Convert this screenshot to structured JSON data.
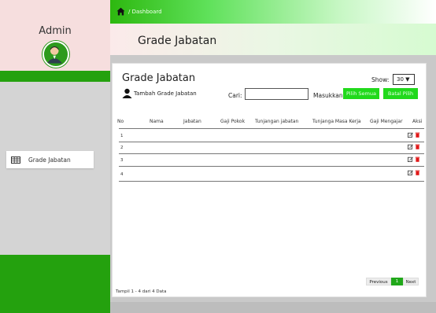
{
  "sidebar": {
    "title": "Admin",
    "menu": [
      {
        "label": "Grade Jabatan",
        "icon": "table-icon"
      }
    ]
  },
  "topbar": {
    "breadcrumb": "/ Dashboard",
    "icon": "home-icon"
  },
  "header": {
    "title": "Grade Jabatan"
  },
  "card": {
    "title": "Grade Jabatan",
    "add_label": "Tambah Grade Jabatan",
    "show_label": "Show:",
    "show_value": "30 ▼",
    "search_label": "Cari:",
    "search_value": "",
    "masukkan_label": "Masukkan:",
    "pilih_semua_label": "Pilih Semua",
    "batal_pilih_label": "Batal Pilih"
  },
  "table": {
    "columns": [
      "No",
      "Nama",
      "Jabatan",
      "Gaji Pokok",
      "Tunjangan jabatan",
      "Tunjanga Masa Kerja",
      "Gaji Mengajar",
      "Aksi"
    ],
    "rows": [
      [
        "1"
      ],
      [
        "2"
      ],
      [
        "3"
      ],
      [
        "4"
      ]
    ]
  },
  "footer": {
    "info": "Tampil 1 - 4 dari 4 Data",
    "prev_label": "Previous",
    "page_label": "1",
    "next_label": "Next"
  },
  "colors": {
    "accent_green": "#24a10e",
    "button_green": "#21d91c",
    "edit_icon": "#333333",
    "delete_icon": "#e01818"
  }
}
